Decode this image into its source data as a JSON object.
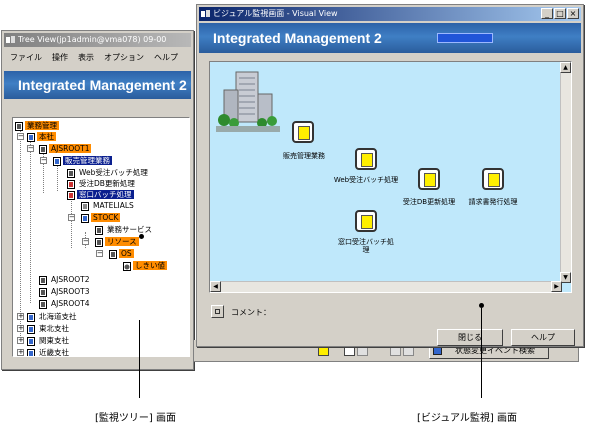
{
  "tree_window": {
    "title": "Tree View(jp1admin@vma078) 09-00",
    "menu": [
      "ファイル",
      "操作",
      "表示",
      "オプション",
      "ヘルプ"
    ],
    "banner": "Integrated Management 2",
    "nodes": [
      {
        "label": "業務管理",
        "style": "orange"
      },
      {
        "label": "本社",
        "style": "orange"
      },
      {
        "label": "AJSROOT1",
        "style": "orange"
      },
      {
        "label": "販売管理業務",
        "style": "blue"
      },
      {
        "label": "Web受注バッチ処理",
        "style": "none"
      },
      {
        "label": "受注DB更新処理",
        "style": "none"
      },
      {
        "label": "窓口バッチ処理",
        "style": "blue"
      },
      {
        "label": "MATELIALS",
        "style": "none"
      },
      {
        "label": "STOCK",
        "style": "orange"
      },
      {
        "label": "業務サービス",
        "style": "none"
      },
      {
        "label": "リソース",
        "style": "orange"
      },
      {
        "label": "OS",
        "style": "orange"
      },
      {
        "label": "しきい値",
        "style": "orange"
      },
      {
        "label": "AJSROOT2",
        "style": "none"
      },
      {
        "label": "AJSROOT3",
        "style": "none"
      },
      {
        "label": "AJSROOT4",
        "style": "none"
      },
      {
        "label": "北海道支社",
        "style": "none"
      },
      {
        "label": "東北支社",
        "style": "none"
      },
      {
        "label": "関東支社",
        "style": "none"
      },
      {
        "label": "近畿支社",
        "style": "none"
      }
    ],
    "bottom_button": "状態変更イベント検索"
  },
  "visual_window": {
    "title": "ビジュアル監視画面 - Visual View",
    "banner": "Integrated Management 2",
    "jobs": [
      {
        "label": "販売管理業務"
      },
      {
        "label": "Web受注バッチ処理"
      },
      {
        "label": "受注DB更新処理"
      },
      {
        "label": "請求書発行処理"
      },
      {
        "label": "窓口受注バッチ処理"
      }
    ],
    "comment_label": "コメント：",
    "close_button": "閉じる",
    "help_button": "ヘルプ"
  },
  "captions": {
    "tree": "[監視ツリー] 画面",
    "visual": "[ビジュアル監視] 画面"
  },
  "colors": {
    "highlight_orange": "#ff8c00",
    "highlight_blue": "#0a1f8f",
    "canvas": "#bfe8fb",
    "banner": "#2c62a8"
  }
}
